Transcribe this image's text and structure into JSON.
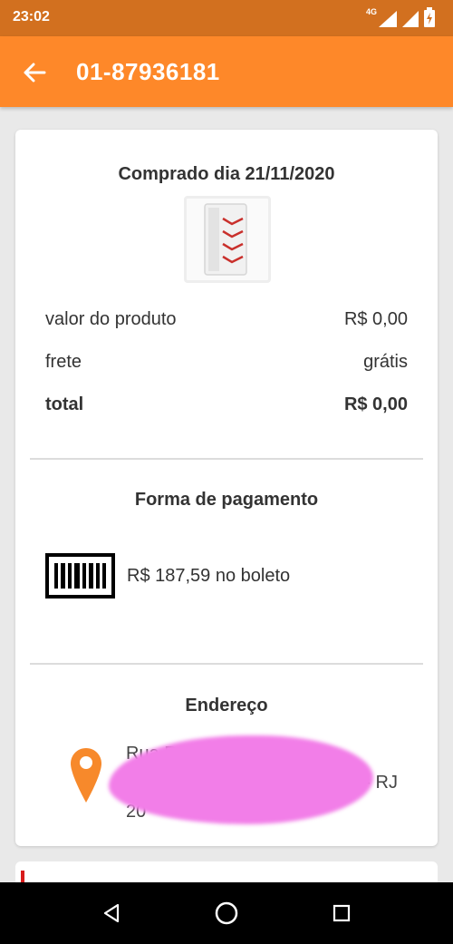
{
  "status_bar": {
    "time": "23:02",
    "network": "4G"
  },
  "app_bar": {
    "title": "01-87936181"
  },
  "order": {
    "purchase_date": "Comprado dia 21/11/2020",
    "product_price_label": "valor do produto",
    "product_price_value": "R$ 0,00",
    "shipping_label": "frete",
    "shipping_value": "grátis",
    "total_label": "total",
    "total_value": "R$ 0,00"
  },
  "payment": {
    "title": "Forma de pagamento",
    "description": "R$ 187,59 no boleto"
  },
  "address": {
    "title": "Endereço",
    "line1": "Rua R",
    "line2": "- RJ",
    "line3": "20"
  },
  "colors": {
    "status_bar": "#d2701f",
    "app_bar": "#fe8829",
    "pin": "#f7892b",
    "redaction": "#f27ee8"
  },
  "icons": {
    "back": "arrow-left-icon",
    "payment": "barcode-icon",
    "address": "location-pin-icon",
    "nav_back": "triangle-back-icon",
    "nav_home": "circle-home-icon",
    "nav_recent": "square-recent-icon"
  }
}
